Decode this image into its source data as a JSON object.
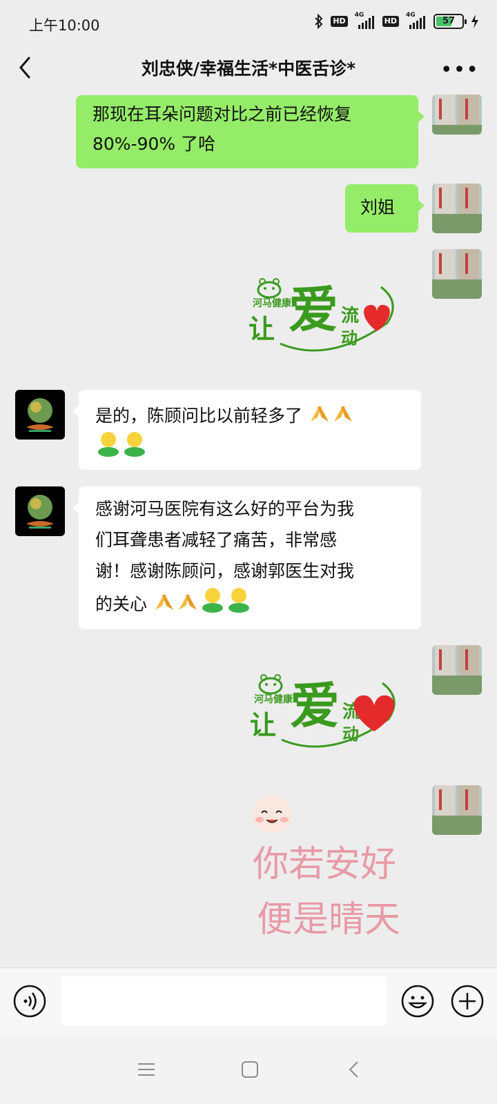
{
  "status_bar": {
    "time": "上午10:00",
    "hd1": "HD",
    "net1": "4G",
    "hd2": "HD",
    "net2": "4G",
    "battery": "57"
  },
  "header": {
    "title": "刘忠侠/幸福生活*中医舌诊*"
  },
  "messages": {
    "m1": {
      "line1": "那现在耳朵问题对比之前已经恢复",
      "line2": "80%-90% 了哈"
    },
    "m2": {
      "text": "刘姐"
    },
    "m3": {
      "text": "是的，陈顾问比以前轻多了"
    },
    "m4": {
      "line1": "感谢河马医院有这么好的平台为我",
      "line2": "们耳聋患者减轻了痛苦，非常感",
      "line3": "谢！感谢陈顾问，感谢郭医生对我",
      "line4": "的关心"
    }
  },
  "stickers": {
    "love": {
      "brand": "河马健康",
      "big": "爱",
      "left": "让",
      "flow1": "流",
      "flow2": "动"
    },
    "greeting": {
      "line1": "你若安好",
      "line2": "便是晴天"
    }
  },
  "colors": {
    "bubble_green": "#95ec69",
    "bubble_white": "#ffffff",
    "background": "#ededed",
    "sticker_green": "#3a9a1e",
    "sticker_pink": "#e89aa6"
  }
}
